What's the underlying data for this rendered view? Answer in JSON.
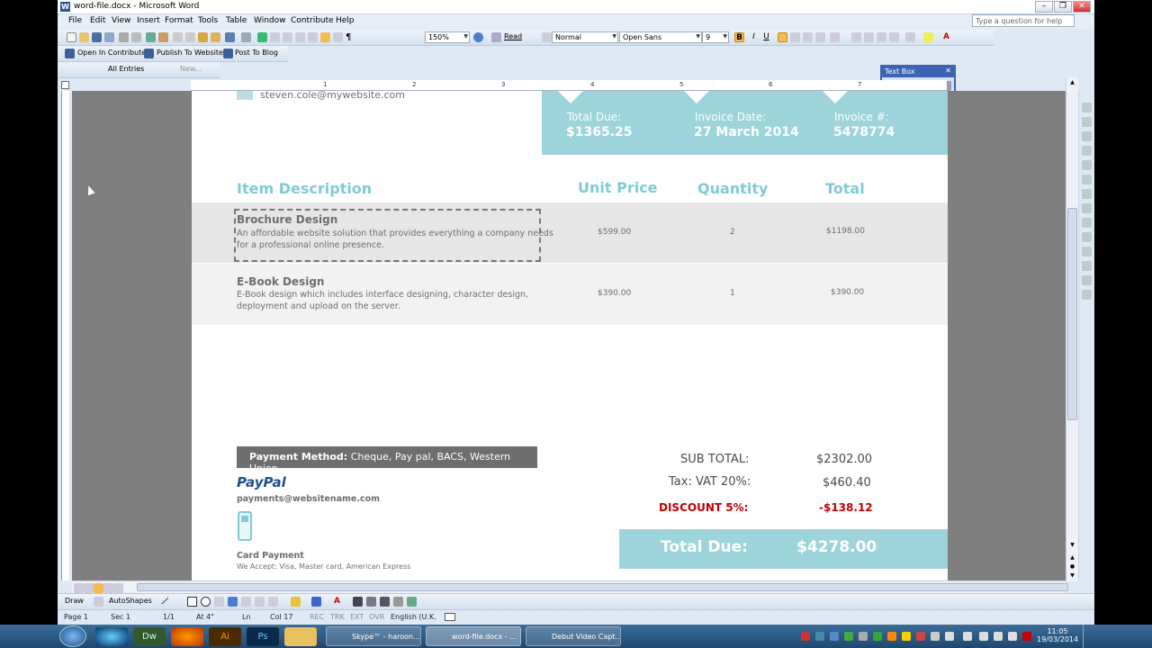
{
  "window": {
    "title": "word-file.docx - Microsoft Word",
    "ask_placeholder": "Type a question for help"
  },
  "menu": [
    "File",
    "Edit",
    "View",
    "Insert",
    "Format",
    "Tools",
    "Table",
    "Window",
    "Contribute",
    "Help"
  ],
  "toolbar": {
    "zoom": "150%",
    "read_label": "Read",
    "style": "Normal",
    "font": "Open Sans",
    "size": "9"
  },
  "contribute_bar": {
    "open_in_contribute": "Open In Contribute",
    "publish": "Publish To Website",
    "post_blog": "Post To Blog",
    "all_entries": "All Entries",
    "new": "New..."
  },
  "textbox_toolbar": {
    "title": "Text Box"
  },
  "ruler": {
    "marks": [
      "1",
      "2",
      "3",
      "4",
      "5",
      "6",
      "7"
    ]
  },
  "document": {
    "email": "steven.cole@mywebsite.com",
    "summary": [
      {
        "label": "Total Due:",
        "value": "$1365.25"
      },
      {
        "label": "Invoice Date:",
        "value": "27 March 2014"
      },
      {
        "label": "Invoice #:",
        "value": "5478774"
      }
    ],
    "table_headers": {
      "item": "Item Description",
      "unit_price": "Unit Price",
      "quantity": "Quantity",
      "total": "Total"
    },
    "items": [
      {
        "name": "Brochure Design",
        "desc1": "An affordable website solution that provides everything a company needs",
        "desc2": "for a professional online presence.",
        "price": "$599.00",
        "qty": "2",
        "total": "$1198.00"
      },
      {
        "name": "E-Book Design",
        "desc1": "E-Book design which includes interface designing, character design,",
        "desc2": "deployment and upload on the server.",
        "price": "$390.00",
        "qty": "1",
        "total": "$390.00"
      }
    ],
    "payment": {
      "method_label": "Payment Method:",
      "method_value": "Cheque, Pay pal, BACS, Western Union.",
      "paypal": "PayPal",
      "paypal_email": "payments@websitename.com",
      "card_title": "Card Payment",
      "card_desc": "We Accept: Visa, Master card, American Express"
    },
    "totals": {
      "subtotal_label": "SUB TOTAL:",
      "subtotal_value": "$2302.00",
      "tax_label": "Tax: VAT 20%:",
      "tax_value": "$460.40",
      "discount_label": "DISCOUNT 5%:",
      "discount_value": "-$138.12",
      "total_label": "Total Due:",
      "total_value": "$4278.00"
    }
  },
  "drawbar": {
    "draw": "Draw",
    "autoshapes": "AutoShapes"
  },
  "status": {
    "page": "Page 1",
    "sec": "Sec 1",
    "pages": "1/1",
    "at": "At 4\"",
    "ln": "Ln",
    "col": "Col 17",
    "rec": "REC",
    "trk": "TRK",
    "ext": "EXT",
    "ovr": "OVR",
    "lang": "English (U.K."
  },
  "taskbar": {
    "windows": [
      {
        "label": "Skype™ - haroon..."
      },
      {
        "label": "word-file.docx - ..."
      },
      {
        "label": "Debut Video Capt..."
      }
    ],
    "time": "11:05",
    "date": "19/03/2014"
  },
  "colors": {
    "accent_teal": "#7fcbd5",
    "header_teal": "#9dd4db",
    "discount_red": "#c00000"
  }
}
